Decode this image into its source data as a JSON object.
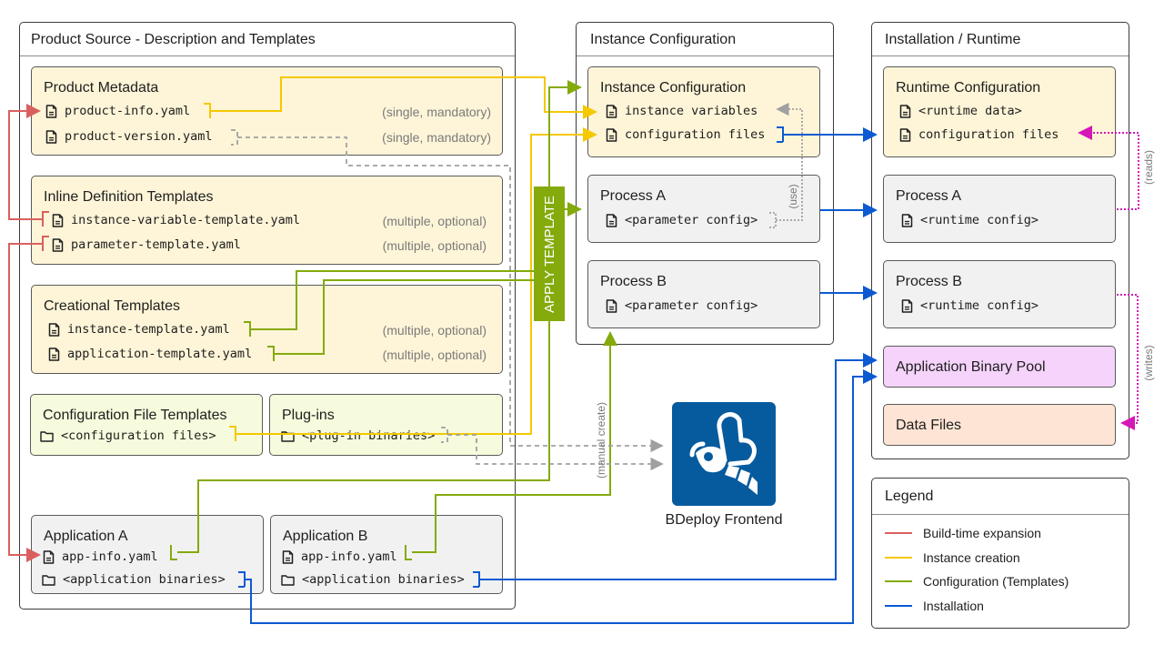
{
  "columns": {
    "product_source": {
      "title": "Product Source - Description and Templates",
      "product_metadata": {
        "title": "Product Metadata",
        "files": [
          {
            "name": "product-info.yaml",
            "note": "(single, mandatory)",
            "icon": "file-icon"
          },
          {
            "name": "product-version.yaml",
            "note": "(single, mandatory)",
            "icon": "file-icon"
          }
        ]
      },
      "inline_templates": {
        "title": "Inline Definition Templates",
        "files": [
          {
            "name": "instance-variable-template.yaml",
            "note": "(multiple, optional)",
            "icon": "file-icon"
          },
          {
            "name": "parameter-template.yaml",
            "note": "(multiple, optional)",
            "icon": "file-icon"
          }
        ]
      },
      "creational_templates": {
        "title": "Creational Templates",
        "files": [
          {
            "name": "instance-template.yaml",
            "note": "(multiple, optional)",
            "icon": "file-icon"
          },
          {
            "name": "application-template.yaml",
            "note": "(multiple, optional)",
            "icon": "file-icon"
          }
        ]
      },
      "config_file_templates": {
        "title": "Configuration File Templates",
        "files": [
          {
            "name": "<configuration files>",
            "icon": "folder-icon"
          }
        ]
      },
      "plugins": {
        "title": "Plug-ins",
        "files": [
          {
            "name": "<plug-in binaries>",
            "icon": "folder-icon"
          }
        ]
      },
      "application_a": {
        "title": "Application A",
        "files": [
          {
            "name": "app-info.yaml",
            "icon": "file-icon"
          },
          {
            "name": "<application binaries>",
            "icon": "folder-icon"
          }
        ]
      },
      "application_b": {
        "title": "Application B",
        "files": [
          {
            "name": "app-info.yaml",
            "icon": "file-icon"
          },
          {
            "name": "<application binaries>",
            "icon": "folder-icon"
          }
        ]
      }
    },
    "instance_configuration": {
      "title": "Instance Configuration",
      "instance_config": {
        "title": "Instance Configuration",
        "files": [
          {
            "name": "instance variables",
            "icon": "file-icon"
          },
          {
            "name": "configuration files",
            "icon": "file-icon"
          }
        ]
      },
      "process_a": {
        "title": "Process A",
        "files": [
          {
            "name": "<parameter config>",
            "icon": "file-icon"
          }
        ]
      },
      "process_b": {
        "title": "Process B",
        "files": [
          {
            "name": "<parameter config>",
            "icon": "file-icon"
          }
        ]
      }
    },
    "installation_runtime": {
      "title": "Installation / Runtime",
      "runtime_config": {
        "title": "Runtime Configuration",
        "files": [
          {
            "name": "<runtime data>",
            "icon": "file-icon"
          },
          {
            "name": "configuration files",
            "icon": "file-icon"
          }
        ]
      },
      "process_a": {
        "title": "Process A",
        "files": [
          {
            "name": "<runtime config>",
            "icon": "file-icon"
          }
        ]
      },
      "process_b": {
        "title": "Process B",
        "files": [
          {
            "name": "<runtime config>",
            "icon": "file-icon"
          }
        ]
      },
      "binary_pool": {
        "title": "Application Binary Pool"
      },
      "data_files": {
        "title": "Data Files"
      }
    }
  },
  "apply_template": "APPLY TEMPLATE",
  "edge_labels": {
    "use": "(use)",
    "reads": "(reads)",
    "writes": "(writes)",
    "manual_create": "(manual create)"
  },
  "frontend": {
    "label": "BDeploy Frontend",
    "icon": "bee-logo-icon",
    "color": "#065b9e"
  },
  "legend": {
    "title": "Legend",
    "items": [
      {
        "label": "Build-time expansion",
        "color": "#d9605f"
      },
      {
        "label": "Instance creation",
        "color": "#f5c800"
      },
      {
        "label": "Configuration (Templates)",
        "color": "#84aa0b"
      },
      {
        "label": "Installation",
        "color": "#0c5ad2"
      }
    ]
  },
  "colors": {
    "red": "#d9605f",
    "yellow": "#f5c800",
    "green": "#84aa0b",
    "blue": "#0c5ad2",
    "magenta": "#d418b8",
    "gray": "#a0a0a0"
  }
}
